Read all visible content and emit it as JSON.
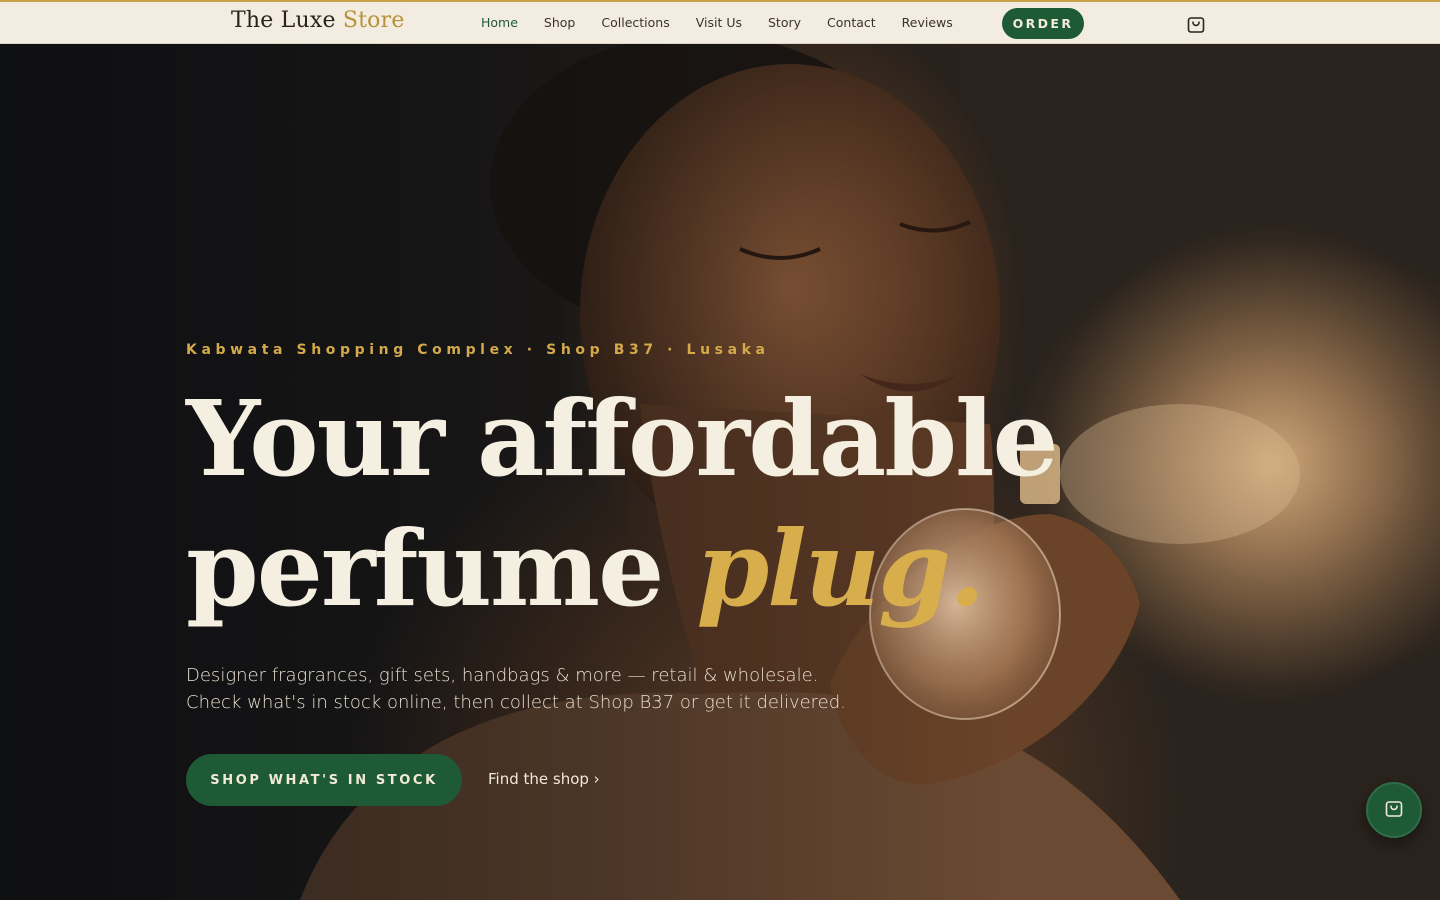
{
  "brand": {
    "name": "The Luxe",
    "accent": "Store"
  },
  "nav": {
    "items": [
      "Home",
      "Shop",
      "Collections",
      "Visit Us",
      "Story",
      "Contact",
      "Reviews"
    ],
    "active": "Home"
  },
  "header": {
    "order_label": "ORDER",
    "cart_icon": "shopping-bag-icon"
  },
  "hero": {
    "eyebrow": "Kabwata Shopping Complex · Shop B37 · Lusaka",
    "headline_line1": "Your affordable",
    "headline_line2_plain": "perfume ",
    "headline_line2_accent": "plug.",
    "subcopy_line1": "Designer fragrances, gift sets, handbags & more — retail & wholesale.",
    "subcopy_line2": "Check what's in stock online, then collect at Shop B37 or get it delivered.",
    "cta_primary": "SHOP WHAT'S IN STOCK",
    "cta_secondary": "Find the shop ›",
    "image": "woman-spraying-perfume-photo"
  },
  "floating": {
    "icon": "shopping-bag-icon"
  },
  "colors": {
    "brand_green": "#1f5a37",
    "gold": "#d8ad4c",
    "cream": "#f3ece0",
    "headline": "#f5efe2"
  }
}
